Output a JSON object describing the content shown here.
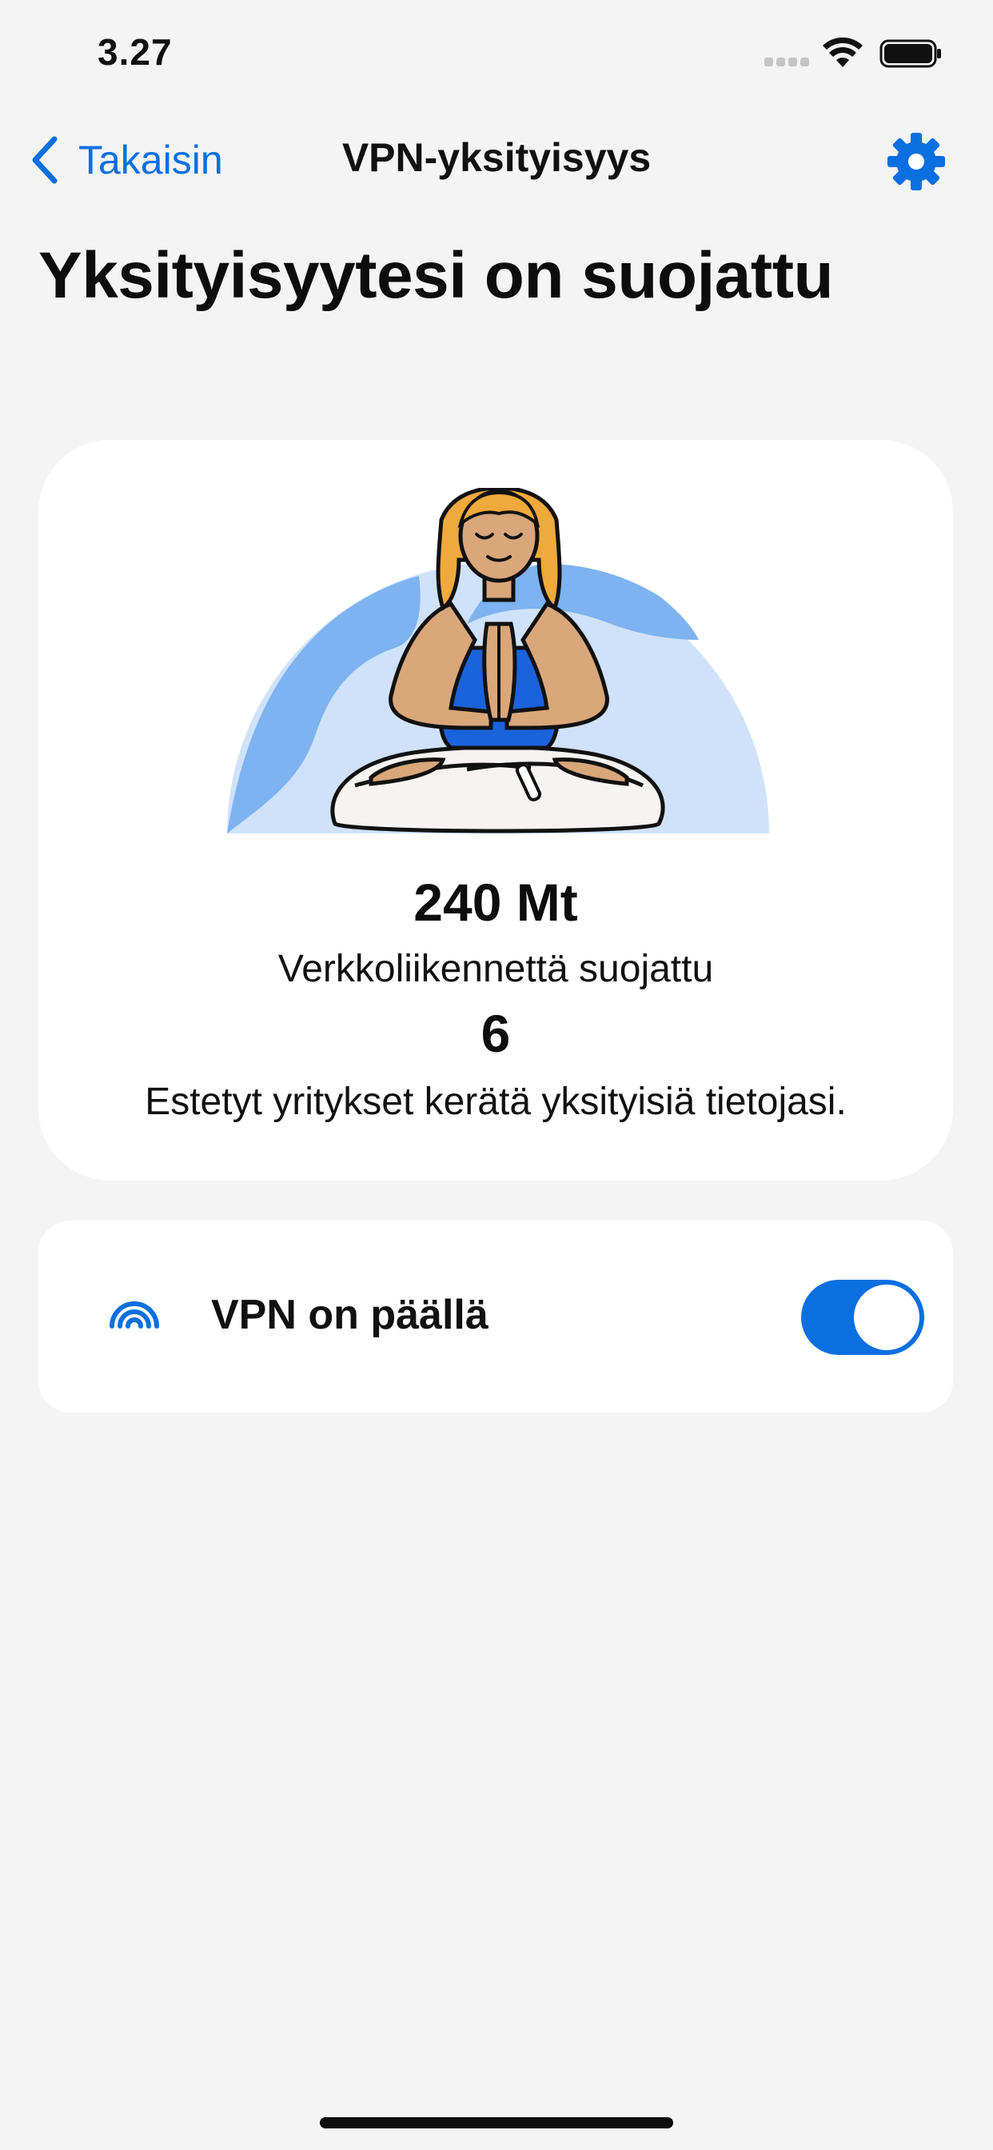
{
  "status_bar": {
    "time": "3.27",
    "icons": [
      "cellular-signal-icon",
      "wifi-icon",
      "battery-icon"
    ]
  },
  "nav": {
    "back_label": "Takaisin",
    "title": "VPN-yksityisyys",
    "settings_icon": "gear-icon"
  },
  "page": {
    "title": "Yksityisyytesi on suojattu"
  },
  "stats": {
    "data_value": "240 Mt",
    "data_label": "Verkkoliikennettä suojattu",
    "trackers_value": "6",
    "trackers_label": "Estetyt yritykset kerätä yksityisiä tietojasi."
  },
  "vpn": {
    "label": "VPN on päällä",
    "enabled": true,
    "icon": "vpn-signal-icon"
  },
  "colors": {
    "accent": "#0a6fe0",
    "background": "#f4f4f4",
    "card": "#ffffff"
  }
}
